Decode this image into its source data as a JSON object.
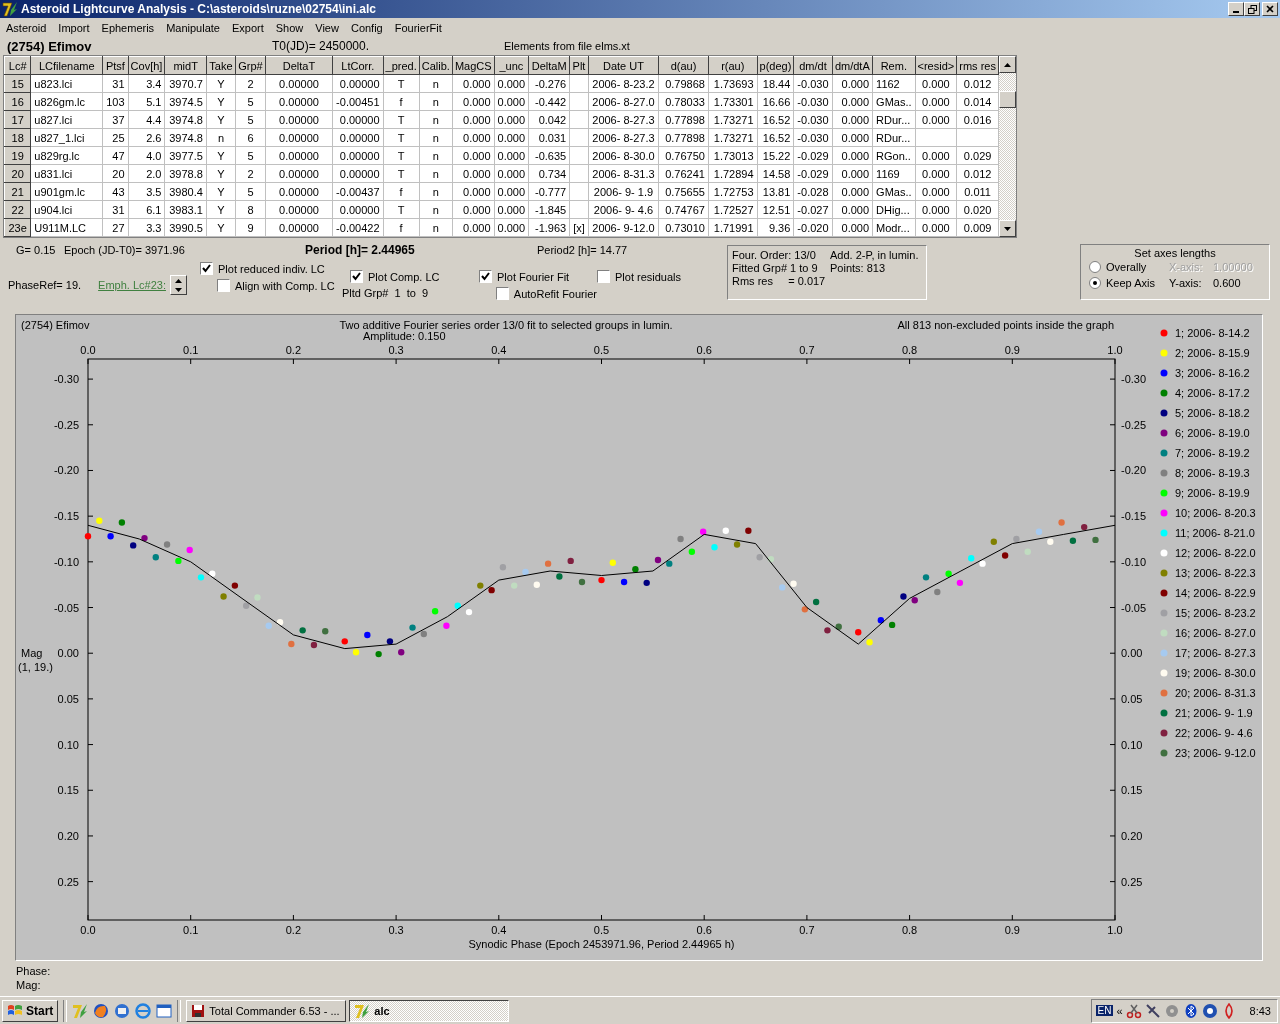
{
  "window": {
    "title": "Asteroid Lightcurve Analysis - C:\\asteroids\\ruzne\\02754\\ini.alc"
  },
  "menu": [
    "Asteroid",
    "Import",
    "Ephemeris",
    "Manipulate",
    "Export",
    "Show",
    "View",
    "Config",
    "FourierFit"
  ],
  "header": {
    "object": "(2754) Efimov",
    "t0": "T0(JD)= 2450000.",
    "elements": "Elements from file elms.xt"
  },
  "table": {
    "columns": [
      "Lc#",
      "LCfilename",
      "Ptsf",
      "Cov[h]",
      "midT",
      "Take",
      "Grp#",
      "DeltaT",
      "LtCorr.",
      "_pred.",
      "Calib.",
      "MagCS",
      "_unc",
      "DeltaM",
      "Plt",
      "Date UT",
      "d(au)",
      "r(au)",
      "p(deg)",
      "dm/dt",
      "dm/dtA",
      "Rem.",
      "<resid>",
      "rms res"
    ],
    "rows": [
      {
        "cells": [
          "15",
          "u823.lci",
          "31",
          "3.4",
          "3970.7",
          "Y",
          "2",
          "0.00000",
          "0.00000",
          "T",
          "n",
          "0.000",
          "0.000",
          "-0.276",
          null,
          "2006- 8-23.2",
          "0.79868",
          "1.73693",
          "18.44",
          "-0.030",
          "0.000",
          "1162",
          "0.000",
          "0.012"
        ]
      },
      {
        "cells": [
          "16",
          "u826gm.lc",
          "103",
          "5.1",
          "3974.5",
          "Y",
          "5",
          "0.00000",
          "-0.00451",
          "f",
          "n",
          "0.000",
          "0.000",
          "-0.442",
          null,
          "2006- 8-27.0",
          "0.78033",
          "1.73301",
          "16.66",
          "-0.030",
          "0.000",
          "GMas..",
          "0.000",
          "0.014"
        ]
      },
      {
        "cells": [
          "17",
          "u827.lci",
          "37",
          "4.4",
          "3974.8",
          "Y",
          "5",
          "0.00000",
          "0.00000",
          "T",
          "n",
          "0.000",
          "0.000",
          "0.042",
          null,
          "2006- 8-27.3",
          "0.77898",
          "1.73271",
          "16.52",
          "-0.030",
          "0.000",
          "RDur...",
          "0.000",
          "0.016"
        ]
      },
      {
        "cells": [
          "18",
          "u827_1.lci",
          "25",
          "2.6",
          "3974.8",
          "n",
          "6",
          "0.00000",
          "0.00000",
          "T",
          "n",
          "0.000",
          "0.000",
          "0.031",
          null,
          "2006- 8-27.3",
          "0.77898",
          "1.73271",
          "16.52",
          "-0.030",
          "0.000",
          "RDur...",
          null,
          null
        ]
      },
      {
        "cells": [
          "19",
          "u829rg.lc",
          "47",
          "4.0",
          "3977.5",
          "Y",
          "5",
          "0.00000",
          "0.00000",
          "T",
          "n",
          "0.000",
          "0.000",
          "-0.635",
          null,
          "2006- 8-30.0",
          "0.76750",
          "1.73013",
          "15.22",
          "-0.029",
          "0.000",
          "RGon..",
          "0.000",
          "0.029"
        ]
      },
      {
        "cells": [
          "20",
          "u831.lci",
          "20",
          "2.0",
          "3978.8",
          "Y",
          "2",
          "0.00000",
          "0.00000",
          "T",
          "n",
          "0.000",
          "0.000",
          "0.734",
          null,
          "2006- 8-31.3",
          "0.76241",
          "1.72894",
          "14.58",
          "-0.029",
          "0.000",
          "1169",
          "0.000",
          "0.012"
        ]
      },
      {
        "cells": [
          "21",
          "u901gm.lc",
          "43",
          "3.5",
          "3980.4",
          "Y",
          "5",
          "0.00000",
          "-0.00437",
          "f",
          "n",
          "0.000",
          "0.000",
          "-0.777",
          null,
          "2006- 9- 1.9",
          "0.75655",
          "1.72753",
          "13.81",
          "-0.028",
          "0.000",
          "GMas..",
          "0.000",
          "0.011"
        ]
      },
      {
        "cells": [
          "22",
          "u904.lci",
          "31",
          "6.1",
          "3983.1",
          "Y",
          "8",
          "0.00000",
          "0.00000",
          "T",
          "n",
          "0.000",
          "0.000",
          "-1.845",
          null,
          "2006- 9- 4.6",
          "0.74767",
          "1.72527",
          "12.51",
          "-0.027",
          "0.000",
          "DHig...",
          "0.000",
          "0.020"
        ]
      },
      {
        "cells": [
          "23e",
          "U911M.LC",
          "27",
          "3.3",
          "3990.5",
          "Y",
          "9",
          "0.00000",
          "-0.00422",
          "f",
          "n",
          "0.000",
          "0.000",
          "-1.963",
          "[x]",
          "2006- 9-12.0",
          "0.73010",
          "1.71991",
          "9.36",
          "-0.020",
          "0.000",
          "Modr...",
          "0.000",
          "0.009"
        ]
      }
    ]
  },
  "controls": {
    "g": "G= 0.15",
    "epoch": "Epoch (JD-T0)= 3971.96",
    "period": "Period [h]= 2.44965",
    "period2": "Period2 [h]= 14.77",
    "phase_ref": "PhaseRef= 19.",
    "emph_link": "Emph. Lc#23:",
    "pltd_grp": "Pltd Grp#  1  to  9",
    "checkboxes": [
      {
        "label": "Plot reduced indiv. LC",
        "checked": true
      },
      {
        "label": "Align with Comp. LC",
        "checked": false
      },
      {
        "label": "Plot Comp. LC",
        "checked": true
      },
      {
        "label": "Plot Fourier Fit",
        "checked": true
      },
      {
        "label": "AutoRefit Fourier",
        "checked": false
      },
      {
        "label": "Plot residuals",
        "checked": false
      }
    ]
  },
  "fit_info": [
    "Four. Order: 13/0",
    "Add. 2-P, in lumin.",
    "Fitted Grp# 1 to 9",
    "Points: 813",
    "Rms res     = 0.017"
  ],
  "axes": {
    "title": "Set axes lengths",
    "radios": [
      {
        "label": "Overally",
        "selected": false
      },
      {
        "label": "Keep Axis",
        "selected": true
      }
    ],
    "fields": [
      {
        "label": "X-axis:",
        "value": "1.00000",
        "disabled": true
      },
      {
        "label": "Y-axis:",
        "value": "0.600",
        "disabled": false
      }
    ]
  },
  "plot": {
    "object": "(2754) Efimov",
    "fit_note": "Two additive Fourier series order 13/0 fit to selected groups in lumin.",
    "amplitude": "Amplitude: 0.150",
    "points_note": "All 813 non-excluded points inside the graph",
    "ylabel_sub": "(1, 19.)",
    "chart_data": {
      "type": "scatter",
      "xlabel": "Synodic Phase (Epoch 2453971.96, Period 2.44965 h)",
      "ylabel": "Mag",
      "xlim": [
        0,
        1
      ],
      "ylim": [
        0.292,
        -0.322
      ],
      "legend": "right",
      "xticks": [
        {
          "value": 0,
          "label": "0.0"
        },
        {
          "value": 0.1,
          "label": "0.1"
        },
        {
          "value": 0.2,
          "label": "0.2"
        },
        {
          "value": 0.3,
          "label": "0.3"
        },
        {
          "value": 0.4,
          "label": "0.4"
        },
        {
          "value": 0.5,
          "label": "0.5"
        },
        {
          "value": 0.6,
          "label": "0.6"
        },
        {
          "value": 0.7,
          "label": "0.7"
        },
        {
          "value": 0.8,
          "label": "0.8"
        },
        {
          "value": 0.9,
          "label": "0.9"
        },
        {
          "value": 1,
          "label": "1.0"
        }
      ],
      "yticks": [
        {
          "value": -0.3,
          "label": "-0.30"
        },
        {
          "value": -0.25,
          "label": "-0.25"
        },
        {
          "value": -0.2,
          "label": "-0.20"
        },
        {
          "value": -0.15,
          "label": "-0.15"
        },
        {
          "value": -0.1,
          "label": "-0.10"
        },
        {
          "value": -0.05,
          "label": "-0.05"
        },
        {
          "value": 0,
          "label": "0.00"
        },
        {
          "value": 0.05,
          "label": "0.05"
        },
        {
          "value": 0.1,
          "label": "0.10"
        },
        {
          "value": 0.15,
          "label": "0.15"
        },
        {
          "value": 0.2,
          "label": "0.20"
        },
        {
          "value": 0.25,
          "label": "0.25"
        }
      ],
      "series": [
        {
          "name": "1; 2006- 8-14.2",
          "color": "#ff0000",
          "x": [
            0,
            0.25,
            0.5,
            0.75
          ],
          "values": [
            -0.128,
            -0.013,
            -0.08,
            -0.023
          ]
        },
        {
          "name": "2; 2006- 8-15.9",
          "color": "#ffff00",
          "x": [
            0.011,
            0.261,
            0.511,
            0.761
          ],
          "values": [
            -0.145,
            -0.001,
            -0.099,
            -0.012
          ]
        },
        {
          "name": "3; 2006- 8-16.2",
          "color": "#0000ff",
          "x": [
            0.022,
            0.272,
            0.522,
            0.772
          ],
          "values": [
            -0.128,
            -0.02,
            -0.078,
            -0.036
          ]
        },
        {
          "name": "4; 2006- 8-17.2",
          "color": "#008000",
          "x": [
            0.033,
            0.283,
            0.533,
            0.783
          ],
          "values": [
            -0.143,
            0.001,
            -0.092,
            -0.031
          ]
        },
        {
          "name": "5; 2006- 8-18.2",
          "color": "#000080",
          "x": [
            0.044,
            0.294,
            0.544,
            0.794
          ],
          "values": [
            -0.118,
            -0.013,
            -0.077,
            -0.062
          ]
        },
        {
          "name": "6; 2006- 8-19.0",
          "color": "#800080",
          "x": [
            0.055,
            0.305,
            0.555,
            0.805
          ],
          "values": [
            -0.126,
            -0.001,
            -0.102,
            -0.058
          ]
        },
        {
          "name": "7; 2006- 8-19.2",
          "color": "#008080",
          "x": [
            0.066,
            0.316,
            0.566,
            0.816
          ],
          "values": [
            -0.105,
            -0.028,
            -0.098,
            -0.083
          ]
        },
        {
          "name": "8; 2006- 8-19.3",
          "color": "#808080",
          "x": [
            0.077,
            0.327,
            0.577,
            0.827
          ],
          "values": [
            -0.119,
            -0.021,
            -0.125,
            -0.067
          ]
        },
        {
          "name": "9; 2006- 8-19.9",
          "color": "#00ff00",
          "x": [
            0.088,
            0.338,
            0.588,
            0.838
          ],
          "values": [
            -0.101,
            -0.046,
            -0.111,
            -0.087
          ]
        },
        {
          "name": "10; 2006- 8-20.3",
          "color": "#ff00ff",
          "x": [
            0.099,
            0.349,
            0.599,
            0.849
          ],
          "values": [
            -0.113,
            -0.03,
            -0.133,
            -0.077
          ]
        },
        {
          "name": "11; 2006- 8-21.0",
          "color": "#00ffff",
          "x": [
            0.11,
            0.36,
            0.61,
            0.86
          ],
          "values": [
            -0.083,
            -0.052,
            -0.116,
            -0.104
          ]
        },
        {
          "name": "12; 2006- 8-22.0",
          "color": "#ffffff",
          "x": [
            0.121,
            0.371,
            0.621,
            0.871
          ],
          "values": [
            -0.087,
            -0.045,
            -0.134,
            -0.098
          ]
        },
        {
          "name": "13; 2006- 8-22.3",
          "color": "#808000",
          "x": [
            0.132,
            0.382,
            0.632,
            0.882
          ],
          "values": [
            -0.062,
            -0.074,
            -0.119,
            -0.122
          ]
        },
        {
          "name": "14; 2006- 8-22.9",
          "color": "#800000",
          "x": [
            0.143,
            0.393,
            0.643,
            0.893
          ],
          "values": [
            -0.074,
            -0.069,
            -0.134,
            -0.107
          ]
        },
        {
          "name": "15; 2006- 8-23.2",
          "color": "#a0a0a4",
          "x": [
            0.154,
            0.404,
            0.654,
            0.904
          ],
          "values": [
            -0.052,
            -0.094,
            -0.105,
            -0.125
          ]
        },
        {
          "name": "16; 2006- 8-27.0",
          "color": "#c0dcc0",
          "x": [
            0.165,
            0.415,
            0.665,
            0.915
          ],
          "values": [
            -0.061,
            -0.074,
            -0.103,
            -0.111
          ]
        },
        {
          "name": "17; 2006- 8-27.3",
          "color": "#a6caf0",
          "x": [
            0.176,
            0.426,
            0.676,
            0.926
          ],
          "values": [
            -0.03,
            -0.089,
            -0.072,
            -0.133
          ]
        },
        {
          "name": "19; 2006- 8-30.0",
          "color": "#fffbf0",
          "x": [
            0.187,
            0.437,
            0.687,
            0.937
          ],
          "values": [
            -0.034,
            -0.075,
            -0.076,
            -0.122
          ]
        },
        {
          "name": "20; 2006- 8-31.3",
          "color": "#e07040",
          "x": [
            0.198,
            0.448,
            0.698,
            0.948
          ],
          "values": [
            -0.01,
            -0.098,
            -0.048,
            -0.143
          ]
        },
        {
          "name": "21; 2006- 9- 1.9",
          "color": "#007040",
          "x": [
            0.209,
            0.459,
            0.709,
            0.959
          ],
          "values": [
            -0.025,
            -0.084,
            -0.056,
            -0.123
          ]
        },
        {
          "name": "22; 2006- 9- 4.6",
          "color": "#802040",
          "x": [
            0.22,
            0.47,
            0.72,
            0.97
          ],
          "values": [
            -0.009,
            -0.101,
            -0.025,
            -0.138
          ]
        },
        {
          "name": "23; 2006- 9-12.0",
          "color": "#407040",
          "x": [
            0.231,
            0.481,
            0.731,
            0.981
          ],
          "values": [
            -0.024,
            -0.078,
            -0.029,
            -0.124
          ]
        },
        {
          "type": "line",
          "color": "#000000",
          "x": [
            0,
            0.05,
            0.1,
            0.15,
            0.2,
            0.25,
            0.3,
            0.35,
            0.4,
            0.45,
            0.5,
            0.55,
            0.6,
            0.65,
            0.7,
            0.75,
            0.8,
            0.85,
            0.9,
            0.95,
            1
          ],
          "values": [
            -0.14,
            -0.125,
            -0.1,
            -0.06,
            -0.02,
            -0.005,
            -0.01,
            -0.04,
            -0.08,
            -0.09,
            -0.085,
            -0.09,
            -0.13,
            -0.12,
            -0.05,
            -0.01,
            -0.06,
            -0.09,
            -0.12,
            -0.13,
            -0.14
          ]
        }
      ]
    }
  },
  "status": {
    "phase": "Phase:",
    "mag": "Mag:"
  },
  "taskbar": {
    "start": "Start",
    "tasks": [
      {
        "label": "Total Commander 6.53 - ...",
        "kind": "disk",
        "selected": false
      },
      {
        "label": "alc",
        "kind": "app",
        "selected": true
      }
    ],
    "language": "EN",
    "chevron": "«",
    "clock": "8:43"
  }
}
